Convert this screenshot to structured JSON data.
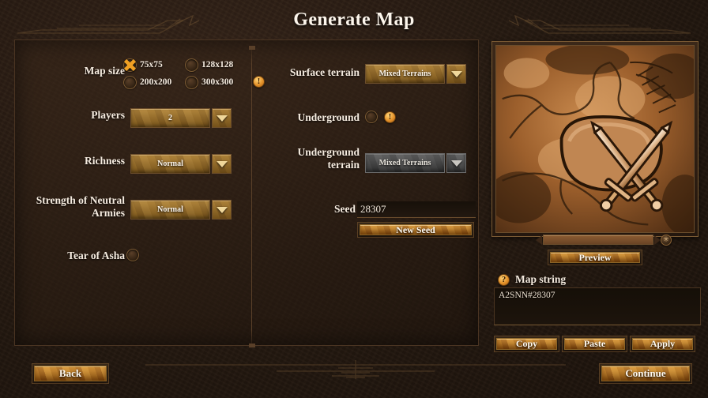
{
  "window": {
    "title": "Generate Map"
  },
  "colors": {
    "accent_gold": "#e4922a",
    "panel_bg": "#241810",
    "button_gold": "#b46c16",
    "text": "#f6ece0",
    "disabled_gray": "#4a4a4a"
  },
  "left_column": {
    "map_size": {
      "label": "Map size",
      "options": [
        {
          "label": "75x75",
          "selected": true
        },
        {
          "label": "128x128",
          "selected": false
        },
        {
          "label": "200x200",
          "selected": false
        },
        {
          "label": "300x300",
          "selected": false
        }
      ],
      "warning_icon": "!"
    },
    "players": {
      "label": "Players",
      "value": "2"
    },
    "richness": {
      "label": "Richness",
      "value": "Normal"
    },
    "neutral_armies": {
      "label_line1": "Strength of Neutral",
      "label_line2": "Armies",
      "value": "Normal"
    },
    "tear_of_asha": {
      "label": "Tear of Asha",
      "checked": false
    }
  },
  "middle_column": {
    "surface_terrain": {
      "label": "Surface terrain",
      "value": "Mixed Terrains",
      "disabled": false
    },
    "underground": {
      "label": "Underground",
      "checked": false,
      "warning_icon": "!"
    },
    "underground_terrain": {
      "label_line1": "Underground",
      "label_line2": "terrain",
      "value": "Mixed Terrains",
      "disabled": true
    },
    "seed": {
      "label": "Seed",
      "value": "28307"
    },
    "new_seed_button": "New Seed"
  },
  "right_panel": {
    "preview_button": "Preview",
    "map_string": {
      "help_icon": "?",
      "label": "Map string",
      "value": "A2SNN#28307"
    },
    "actions": [
      {
        "label": "Copy"
      },
      {
        "label": "Paste"
      },
      {
        "label": "Apply"
      }
    ]
  },
  "footer": {
    "back_button": "Back",
    "continue_button": "Continue"
  }
}
